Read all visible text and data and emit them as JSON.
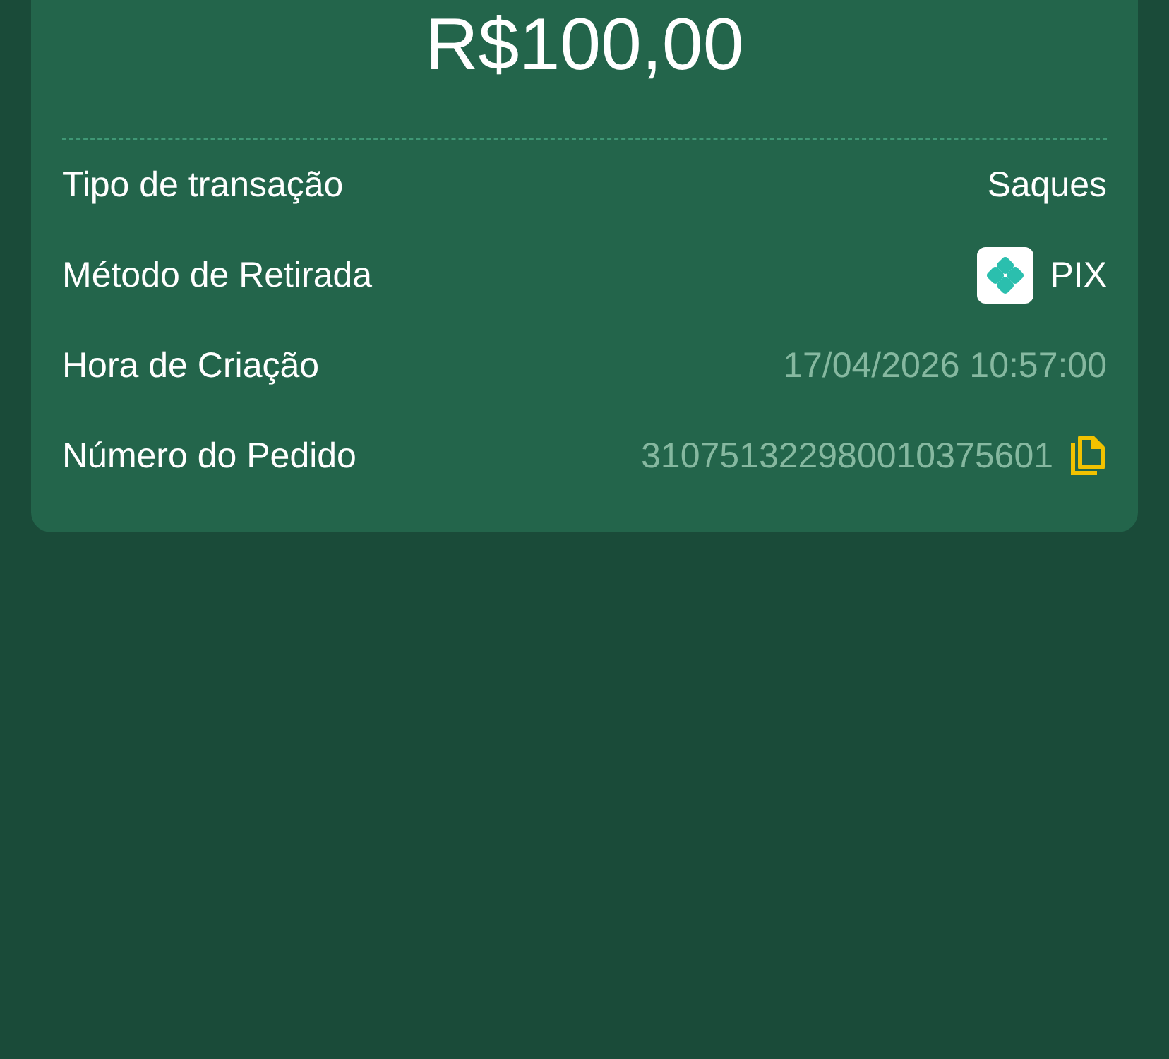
{
  "amount": "R$100,00",
  "rows": [
    {
      "label": "Tipo de transação",
      "value": "Saques",
      "kind": "plain"
    },
    {
      "label": "Método de Retirada",
      "value": "PIX",
      "kind": "pix"
    },
    {
      "label": "Hora de Criação",
      "value": "17/04/2026 10:57:00",
      "kind": "muted"
    },
    {
      "label": "Número do Pedido",
      "value": "310751322980010375601",
      "kind": "copy"
    }
  ]
}
